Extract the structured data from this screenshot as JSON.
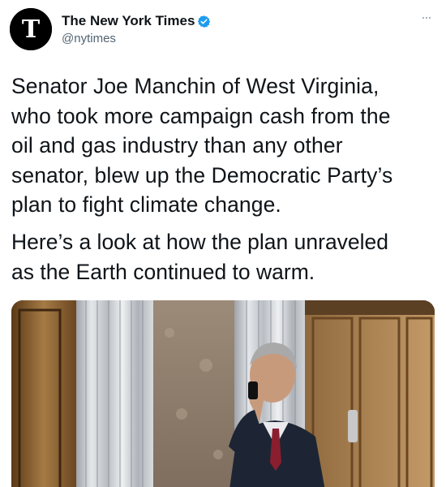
{
  "account": {
    "display_name": "The New York Times",
    "handle": "@nytimes",
    "avatar_icon": "nyt-logo-icon",
    "verified_icon": "verified-badge-icon",
    "verified_color": "#1d9bf0"
  },
  "tweet": {
    "paragraph1_lines": [
      "Senator Joe Manchin of West Virginia,",
      "who took more campaign cash from the",
      "oil and gas industry than any other",
      "senator, blew up the Democratic Party’s",
      "plan to fight climate change."
    ],
    "paragraph2_lines": [
      "Here’s a look at how the plan unraveled",
      "as the Earth continued to warm."
    ],
    "media_icon": "photo-senator-phone-icon"
  },
  "menu_icon": "more-options-icon"
}
